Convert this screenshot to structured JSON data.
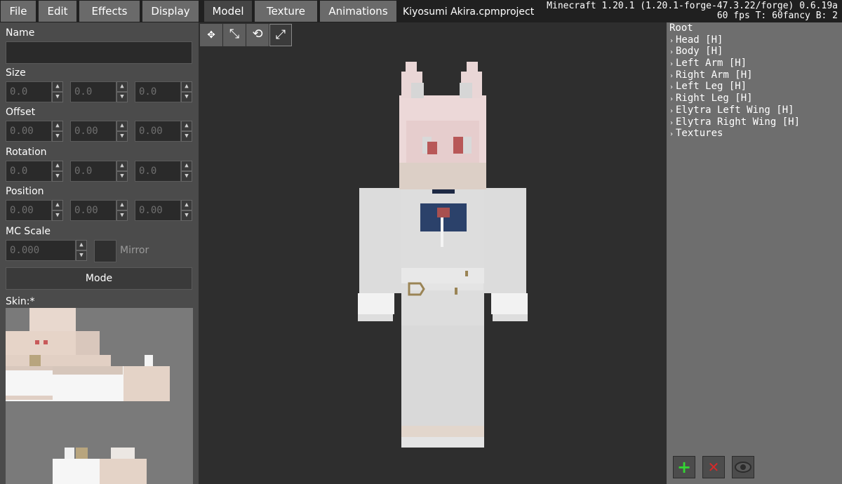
{
  "menubar": {
    "menus": [
      "File",
      "Edit",
      "Effects",
      "Display"
    ],
    "tabs": [
      "Model",
      "Texture",
      "Animations"
    ],
    "active_tab": "Model",
    "project_title": "Kiyosumi Akira.cpmproject",
    "mc_version": "Minecraft 1.20.1 (1.20.1-forge-47.3.22/forge) 0.6.19a",
    "fps_info": "60 fps T: 60fancy B: 2"
  },
  "left_panel": {
    "name_label": "Name",
    "name_value": "",
    "size_label": "Size",
    "size_values": [
      "0.0",
      "0.0",
      "0.0"
    ],
    "offset_label": "Offset",
    "offset_values": [
      "0.00",
      "0.00",
      "0.00"
    ],
    "rotation_label": "Rotation",
    "rotation_values": [
      "0.0",
      "0.0",
      "0.0"
    ],
    "position_label": "Position",
    "position_values": [
      "0.00",
      "0.00",
      "0.00"
    ],
    "mc_scale_label": "MC Scale",
    "mc_scale_value": "0.000",
    "mirror_label": "Mirror",
    "mode_button": "Mode",
    "skin_label": "Skin:*"
  },
  "toolbar": {
    "tools": [
      {
        "name": "move-tool",
        "icon": "move-arrows-icon",
        "glyph": "✥"
      },
      {
        "name": "size-tool",
        "icon": "resize-icon",
        "glyph": "⤡"
      },
      {
        "name": "rotate-tool",
        "icon": "rotate-icon",
        "glyph": "⟲"
      },
      {
        "name": "offset-tool",
        "icon": "offset-icon",
        "glyph": "⤢"
      }
    ],
    "active_tool": "offset-tool"
  },
  "tree": {
    "root": "Root",
    "items": [
      "Head [H]",
      "Body [H]",
      "Left Arm [H]",
      "Right Arm [H]",
      "Left Leg [H]",
      "Right Leg [H]",
      "Elytra Left Wing [H]",
      "Elytra Right Wing [H]",
      "Textures"
    ]
  },
  "actions": {
    "add_glyph": "+",
    "delete_glyph": "✕",
    "add_color": "#33d633",
    "delete_color": "#d62a2a",
    "visibility_icon": "eye-icon"
  },
  "colors": {
    "menubar_bg": "#202020",
    "menu_button": "#6a6a6a",
    "left_panel": "#4b4b4b",
    "right_panel": "#6e6e6e",
    "viewport": "#2e2e2e"
  }
}
